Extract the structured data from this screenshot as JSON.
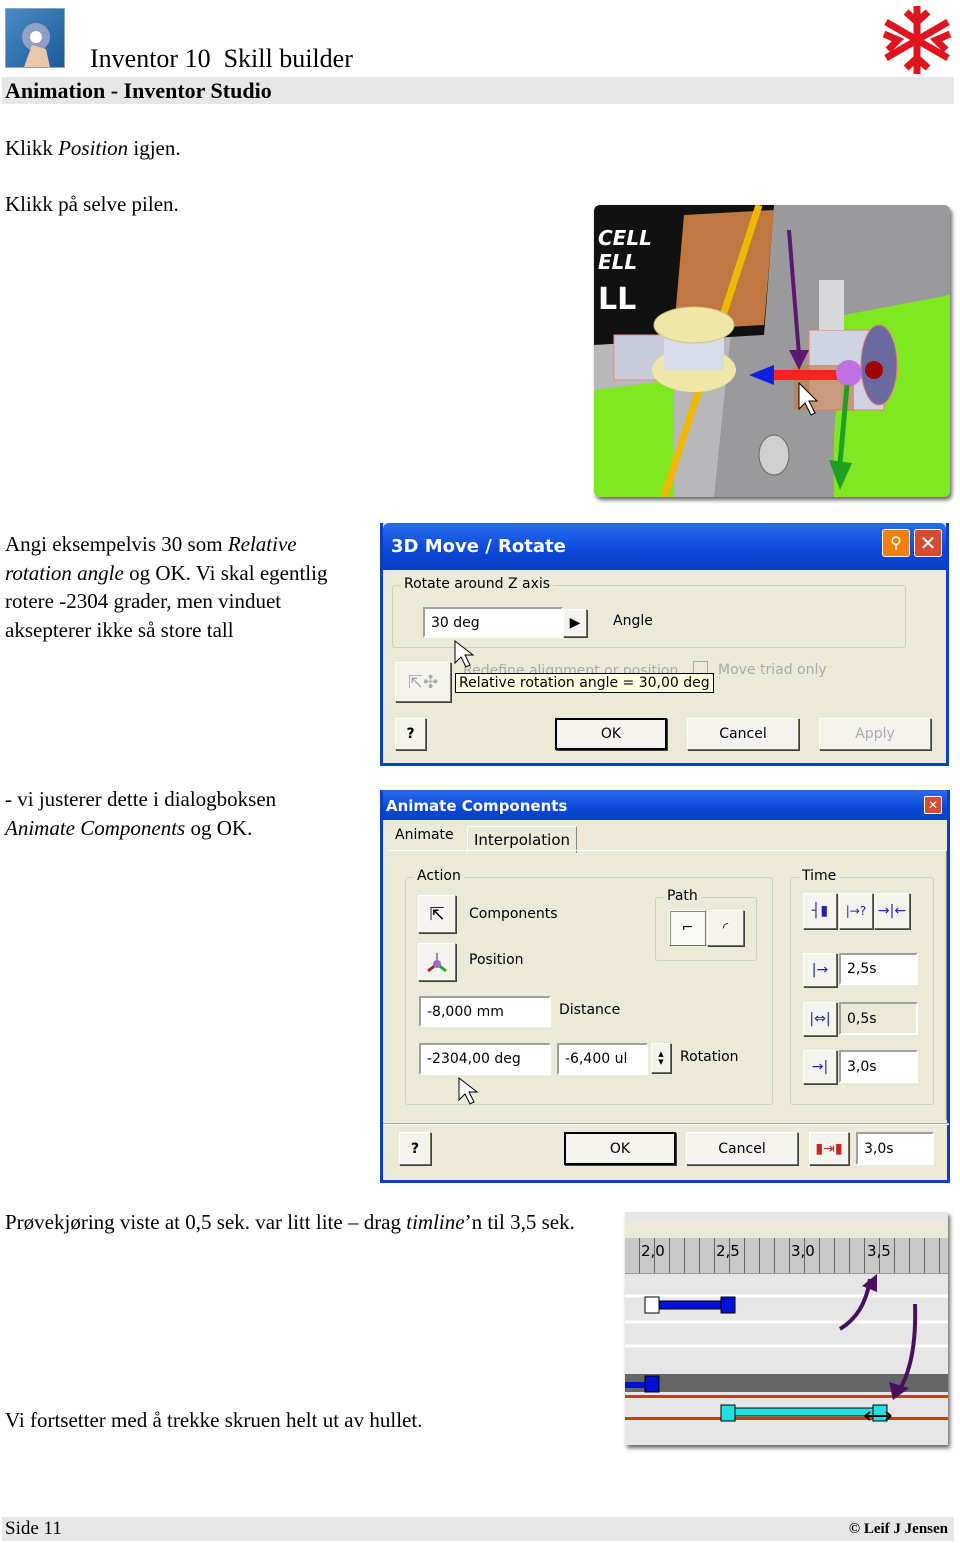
{
  "header": {
    "title": "Inventor 10  Skill builder",
    "section": "Animation - Inventor Studio"
  },
  "text": {
    "p1_a": "Klikk ",
    "p1_em": "Position",
    "p1_b": " igjen.",
    "p2": "Klikk på selve pilen.",
    "p3_a": "Angi eksempelvis 30 som ",
    "p3_em": "Relative rotation angle",
    "p3_b": " og OK. Vi skal egentlig rotere -2304 grader, men vinduet aksepterer ikke så store tall",
    "p4_a": "- vi justerer dette i dialogboksen ",
    "p4_em": "Animate Components",
    "p4_b": " og OK.",
    "p5_a": "Prøvekjøring viste at 0,5 sek. var litt lite – drag ",
    "p5_em": "timline",
    "p5_b": "’n til 3,5 sek.",
    "p6": "Vi fortsetter med å trekke skruen helt ut av hullet."
  },
  "render": {
    "battery_label_lines": [
      "CELL",
      "ELL",
      "LL"
    ]
  },
  "dialog_move": {
    "title": "3D Move / Rotate",
    "group": "Rotate around Z axis",
    "angle_value": "30 deg",
    "angle_label": "Angle",
    "hidden_label": "Redefine alignment or position",
    "triad_only": "Move triad only",
    "tooltip": "Relative rotation angle = 30,00 deg",
    "ok": "OK",
    "cancel": "Cancel",
    "apply": "Apply",
    "help": "?"
  },
  "dialog_anim": {
    "title": "Animate Components",
    "tabs": [
      "Animate",
      "Interpolation"
    ],
    "action": "Action",
    "components": "Components",
    "position": "Position",
    "path": "Path",
    "distance_value": "-8,000 mm",
    "distance_label": "Distance",
    "rotation_value": "-2304,00 deg",
    "rotation_ul": "-6,400 ul",
    "rotation_label": "Rotation",
    "time": "Time",
    "start": "2,5s",
    "duration": "0,5s",
    "end": "3,0s",
    "ok": "OK",
    "cancel": "Cancel",
    "total": "3,0s",
    "help": "?"
  },
  "timeline": {
    "ticks": [
      "2,0",
      "2,5",
      "3,0",
      "3,5"
    ]
  },
  "footer": {
    "page": "Side 11",
    "copyright": "© Leif J Jensen"
  },
  "colors": {
    "titlebar": "#0a48d8",
    "dialog_bg": "#ece9d8",
    "header_band": "#e6e6e6",
    "logo_red": "#e0141e"
  }
}
